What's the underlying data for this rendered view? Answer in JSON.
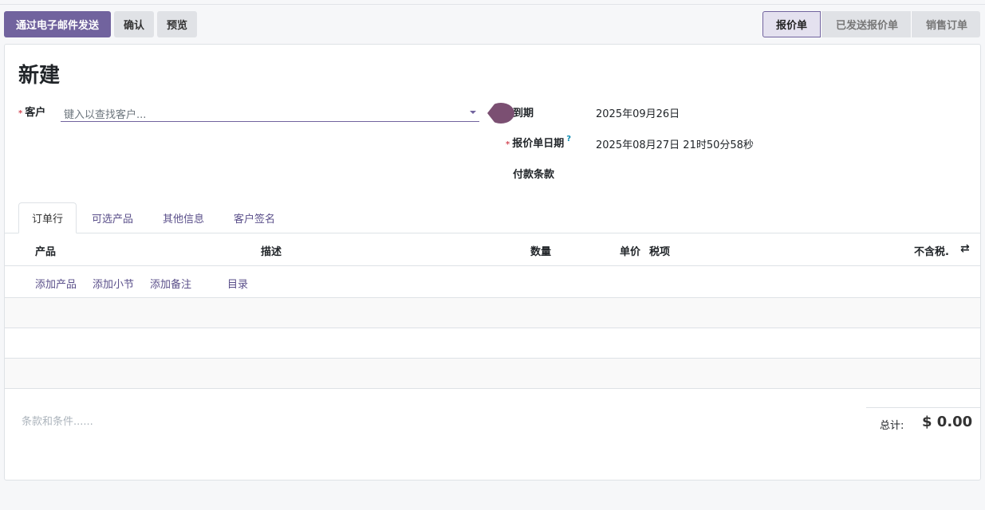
{
  "toolbar": {
    "send_email": "通过电子邮件发送",
    "confirm": "确认",
    "preview": "预览"
  },
  "statusbar": [
    "报价单",
    "已发送报价单",
    "销售订单"
  ],
  "form": {
    "title": "新建",
    "customer_label": "客户",
    "customer_placeholder": "键入以查找客户...",
    "expiration_label": "到期",
    "expiration_value": "2025年09月26日",
    "quote_date_label": "报价单日期",
    "quote_date_help": "?",
    "quote_date_value": "2025年08月27日 21时50分58秒",
    "payment_terms_label": "付款条款",
    "required_mark": "*"
  },
  "tabs": [
    "订单行",
    "可选产品",
    "其他信息",
    "客户签名"
  ],
  "table": {
    "headers": [
      "产品",
      "描述",
      "数量",
      "单价",
      "税项",
      "不含税."
    ],
    "actions": [
      "添加产品",
      "添加小节",
      "添加备注",
      "目录"
    ]
  },
  "footer": {
    "terms_placeholder": "条款和条件......",
    "total_label": "总计:",
    "total_value": "$ 0.00"
  }
}
